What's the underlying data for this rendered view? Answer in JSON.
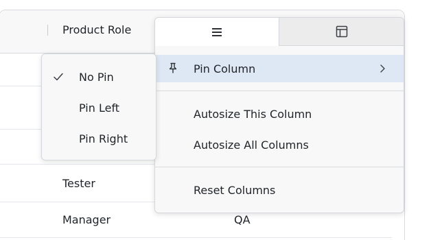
{
  "grid": {
    "header": {
      "column_label": "Product Role"
    },
    "rows": [
      {
        "role": "",
        "team": ""
      },
      {
        "role": "",
        "team": ""
      },
      {
        "role": "",
        "team": ""
      },
      {
        "role": "Tester",
        "team": ""
      },
      {
        "role": "Manager",
        "team": "QA"
      }
    ]
  },
  "column_menu": {
    "tabs": [
      {
        "name": "general",
        "icon": "menu-icon",
        "active": true
      },
      {
        "name": "columns",
        "icon": "columns-icon",
        "active": false
      }
    ],
    "items": [
      {
        "label": "Pin Column",
        "icon": "pin-icon",
        "has_submenu": true,
        "highlighted": true
      },
      {
        "label": "Autosize This Column"
      },
      {
        "label": "Autosize All Columns"
      },
      {
        "label": "Reset Columns"
      }
    ]
  },
  "pin_submenu": {
    "items": [
      {
        "label": "No Pin",
        "checked": true
      },
      {
        "label": "Pin Left",
        "checked": false
      },
      {
        "label": "Pin Right",
        "checked": false
      }
    ]
  },
  "colors": {
    "highlight": "#dde8f4",
    "menu_background": "#f8f8f8",
    "border": "#d4d7dc"
  }
}
